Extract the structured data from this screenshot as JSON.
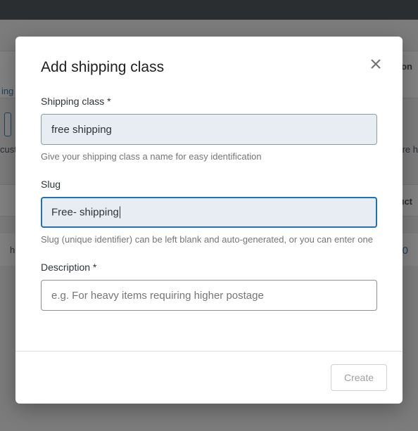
{
  "background": {
    "screen_opts_fragment": "on",
    "link_fragment": "ing",
    "cust_fragment": "cust",
    "right_fragment": "ire h",
    "uct_fragment": "uct",
    "row_left": "h",
    "row_right": "0"
  },
  "modal": {
    "title": "Add shipping class",
    "fields": {
      "name": {
        "label": "Shipping class *",
        "value": "free shipping",
        "help": "Give your shipping class a name for easy identification"
      },
      "slug": {
        "label": "Slug",
        "value": "Free- shipping",
        "help": "Slug (unique identifier) can be left blank and auto-generated, or you can enter one"
      },
      "description": {
        "label": "Description *",
        "placeholder": "e.g. For heavy items requiring higher postage",
        "value": ""
      }
    },
    "create_label": "Create"
  }
}
